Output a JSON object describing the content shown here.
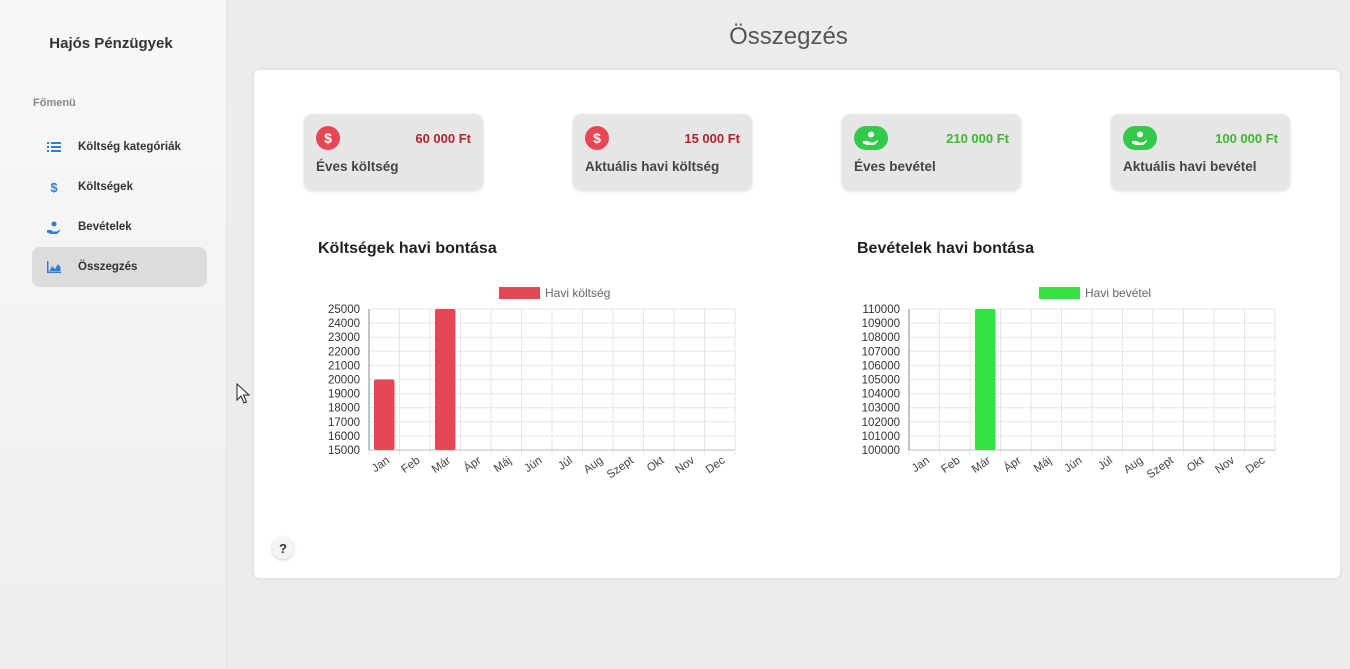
{
  "app": {
    "brand": "Hajós Pénzügyek"
  },
  "sidebar": {
    "section_label": "Főmenü",
    "items": [
      {
        "label": "Költség kategóriák",
        "icon": "list-icon",
        "active": false
      },
      {
        "label": "Költségek",
        "icon": "dollar-icon",
        "active": false
      },
      {
        "label": "Bevételek",
        "icon": "hand-coin-icon",
        "active": false
      },
      {
        "label": "Összegzés",
        "icon": "chart-area-icon",
        "active": true
      }
    ]
  },
  "page": {
    "title": "Összegzés"
  },
  "colors": {
    "expense": "#e74755",
    "expense_text": "#b8202c",
    "income": "#33e144",
    "income_text": "#3cb82e",
    "accent": "#2f7fd1"
  },
  "summary_cards": [
    {
      "label": "Éves költség",
      "value": "60 000 Ft",
      "icon": "dollar-circle-icon",
      "type": "expense"
    },
    {
      "label": "Aktuális havi költség",
      "value": "15 000 Ft",
      "icon": "dollar-circle-icon",
      "type": "expense"
    },
    {
      "label": "Éves bevétel",
      "value": "210 000 Ft",
      "icon": "hand-coin-icon",
      "type": "income"
    },
    {
      "label": "Aktuális havi bevétel",
      "value": "100 000 Ft",
      "icon": "hand-coin-icon",
      "type": "income"
    }
  ],
  "chart_data": [
    {
      "type": "bar",
      "title": "Költségek havi bontása",
      "categories": [
        "Jan",
        "Feb",
        "Már",
        "Ápr",
        "Máj",
        "Jún",
        "Júl",
        "Aug",
        "Szept",
        "Okt",
        "Nov",
        "Dec"
      ],
      "series": [
        {
          "name": "Havi költség",
          "values": [
            20000,
            0,
            25000,
            0,
            0,
            0,
            0,
            0,
            0,
            0,
            0,
            0
          ]
        }
      ],
      "ylim": [
        15000,
        25000
      ],
      "yticks": [
        "25000",
        "24000",
        "23000",
        "22000",
        "21000",
        "20000",
        "19000",
        "18000",
        "17000",
        "16000",
        "15000"
      ],
      "legend": "top",
      "grid": true,
      "color": "#e74755"
    },
    {
      "type": "bar",
      "title": "Bevételek havi bontása",
      "categories": [
        "Jan",
        "Feb",
        "Már",
        "Ápr",
        "Máj",
        "Jún",
        "Júl",
        "Aug",
        "Szept",
        "Okt",
        "Nov",
        "Dec"
      ],
      "series": [
        {
          "name": "Havi bevétel",
          "values": [
            0,
            0,
            110000,
            0,
            0,
            0,
            0,
            0,
            0,
            0,
            0,
            0
          ]
        }
      ],
      "ylim": [
        100000,
        110000
      ],
      "yticks": [
        "110000",
        "109000",
        "108000",
        "107000",
        "106000",
        "105000",
        "104000",
        "103000",
        "102000",
        "101000",
        "100000"
      ],
      "legend": "top",
      "grid": true,
      "color": "#33e144"
    }
  ],
  "help": {
    "label": "?"
  }
}
